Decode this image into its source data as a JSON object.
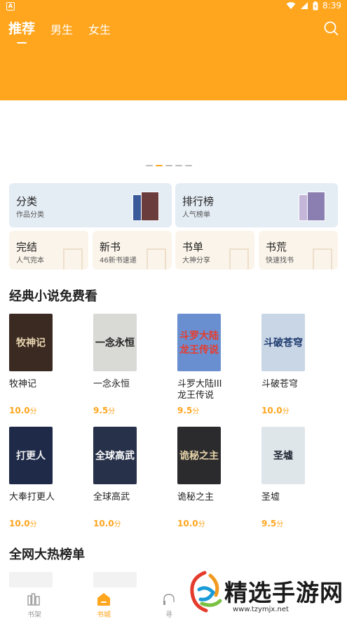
{
  "status_bar": {
    "left_icon_letter": "A",
    "icons": [
      "wifi-icon",
      "signal-icon",
      "battery-icon"
    ],
    "time": "8:39"
  },
  "header": {
    "background": "#FFA51E",
    "tabs": [
      {
        "label": "推荐",
        "active": true
      },
      {
        "label": "男生",
        "active": false
      },
      {
        "label": "女生",
        "active": false
      }
    ],
    "search_icon": "search-icon"
  },
  "banner": {
    "dot_count": 5,
    "active_dot": 1
  },
  "categories": {
    "large": [
      {
        "title": "分类",
        "subtitle": "作品分类"
      },
      {
        "title": "排行榜",
        "subtitle": "人气榜单"
      }
    ],
    "small": [
      {
        "title": "完结",
        "subtitle": "人气完本"
      },
      {
        "title": "新书",
        "subtitle": "46新书速递"
      },
      {
        "title": "书单",
        "subtitle": "大神分享"
      },
      {
        "title": "书荒",
        "subtitle": "快速找书"
      }
    ]
  },
  "section_free": {
    "title": "经典小说免费看",
    "books": [
      {
        "name": "牧神记",
        "score": "10.0",
        "unit": "分",
        "cover_text": "牧神记",
        "cover_bg": "#3b2a22",
        "cover_fg": "#e8d6b0"
      },
      {
        "name": "一念永恒",
        "score": "9.5",
        "unit": "分",
        "cover_text": "一念永恒",
        "cover_bg": "#d9d9d6",
        "cover_fg": "#222222"
      },
      {
        "name": "斗罗大陆III龙王传说",
        "score": "9.5",
        "unit": "分",
        "cover_text": "斗罗大陆 龙王传说",
        "cover_bg": "#6a8fd0",
        "cover_fg": "#e83b2c"
      },
      {
        "name": "斗破苍穹",
        "score": "10.0",
        "unit": "分",
        "cover_text": "斗破苍穹",
        "cover_bg": "#c9d6e6",
        "cover_fg": "#1d3a6e"
      },
      {
        "name": "大奉打更人",
        "score": "10.0",
        "unit": "分",
        "cover_text": "打更人",
        "cover_bg": "#1e2a48",
        "cover_fg": "#f1f1f1"
      },
      {
        "name": "全球高武",
        "score": "10.0",
        "unit": "分",
        "cover_text": "全球高武",
        "cover_bg": "#27324a",
        "cover_fg": "#ffffff"
      },
      {
        "name": "诡秘之主",
        "score": "10.0",
        "unit": "分",
        "cover_text": "诡秘之主",
        "cover_bg": "#2b2b2e",
        "cover_fg": "#e6d3a8"
      },
      {
        "name": "圣墟",
        "score": "9.5",
        "unit": "分",
        "cover_text": "圣墟",
        "cover_bg": "#dfe6ea",
        "cover_fg": "#1c2430"
      }
    ]
  },
  "section_hot": {
    "title": "全网大热榜单"
  },
  "bottom_nav": [
    {
      "label": "书架",
      "icon": "bookshelf-icon",
      "active": false
    },
    {
      "label": "书城",
      "icon": "home-icon",
      "active": true
    },
    {
      "label": "寻",
      "icon": "headphones-icon",
      "active": false
    }
  ],
  "watermark": {
    "text": "精选手游网",
    "url": "www.tzymjx.net"
  }
}
